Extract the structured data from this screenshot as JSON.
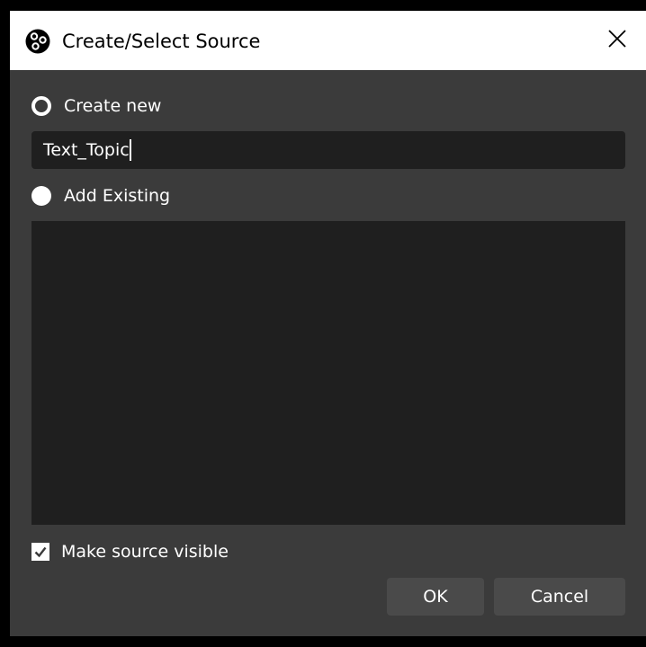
{
  "window": {
    "title": "Create/Select Source",
    "app_icon": "obs-logo-icon",
    "close_icon": "close-icon"
  },
  "options": {
    "create_new": {
      "label": "Create new",
      "selected": true
    },
    "add_existing": {
      "label": "Add Existing",
      "selected": false
    }
  },
  "name_input": {
    "value": "Text_Topic",
    "focused": true
  },
  "existing_sources": {
    "items": []
  },
  "make_visible": {
    "label": "Make source visible",
    "checked": true
  },
  "buttons": {
    "ok": "OK",
    "cancel": "Cancel"
  },
  "colors": {
    "dialog_bg": "#3b3b3b",
    "field_bg": "#1f1f1f",
    "button_bg": "#4a4a4a",
    "titlebar_bg": "#ffffff",
    "text": "#ffffff"
  }
}
